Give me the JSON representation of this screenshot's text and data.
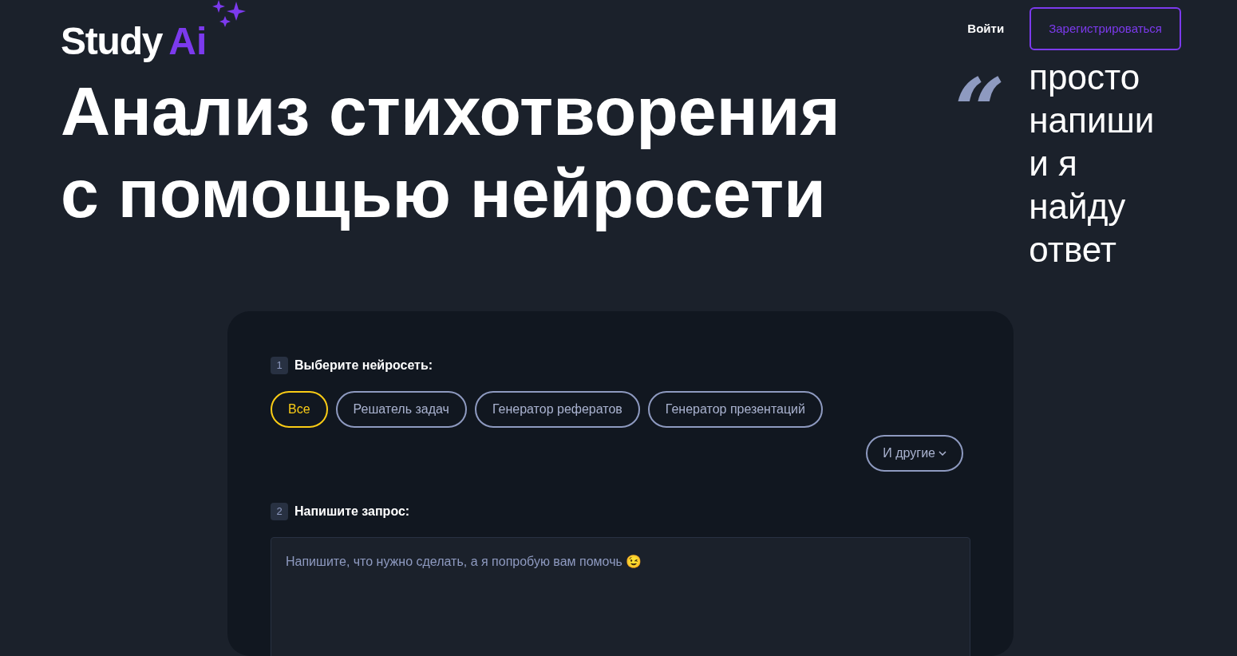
{
  "logo": {
    "word": "Study",
    "accent": "Ai"
  },
  "nav": {
    "login": "Войти",
    "register": "Зарегистрироваться"
  },
  "hero": {
    "title_lines": [
      "Анализ стихотворения",
      "с помощью нейросети"
    ],
    "quote_mark": "“",
    "tagline_lines": [
      "просто",
      "напиши",
      "и я",
      "найду",
      "ответ"
    ]
  },
  "form": {
    "step1": {
      "number": "1",
      "label": "Выберите нейросеть:"
    },
    "chips": [
      {
        "label": "Все",
        "selected": true
      },
      {
        "label": "Решатель задач",
        "selected": false
      },
      {
        "label": "Генератор рефератов",
        "selected": false
      },
      {
        "label": "Генератор презентаций",
        "selected": false
      }
    ],
    "more": {
      "label": "И другие"
    },
    "step2": {
      "number": "2",
      "label": "Напишите запрос:"
    },
    "request": {
      "placeholder": "Напишите, что нужно сделать, а я попробую вам помочь 😉"
    }
  }
}
